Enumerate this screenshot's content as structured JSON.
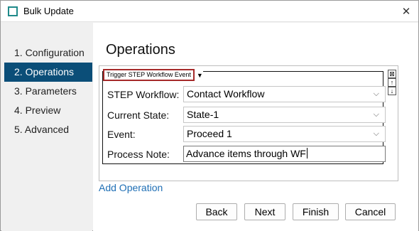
{
  "window": {
    "title": "Bulk Update",
    "close_glyph": "✕"
  },
  "icons": {
    "app": "window-icon",
    "close": "close-icon",
    "dropdown": "chevron-down-icon"
  },
  "sidebar": {
    "items": [
      {
        "label": "1. Configuration",
        "active": false
      },
      {
        "label": "2. Operations",
        "active": true
      },
      {
        "label": "3. Parameters",
        "active": false
      },
      {
        "label": "4. Preview",
        "active": false
      },
      {
        "label": "5. Advanced",
        "active": false
      }
    ]
  },
  "main": {
    "heading": "Operations",
    "operation": {
      "title": "Trigger STEP Workflow Event",
      "title_caret": "▼",
      "controls": {
        "remove": "⊠",
        "move_up": "↑",
        "move_down": "↓"
      },
      "fields": [
        {
          "label": "STEP Workflow:",
          "value": "Contact Workflow",
          "kind": "select"
        },
        {
          "label": "Current State:",
          "value": "State-1",
          "kind": "select"
        },
        {
          "label": "Event:",
          "value": "Proceed 1",
          "kind": "select"
        },
        {
          "label": "Process Note:",
          "value": "Advance items through WF",
          "kind": "text"
        }
      ]
    },
    "add_operation": "Add Operation"
  },
  "footer": {
    "back": "Back",
    "next": "Next",
    "finish": "Finish",
    "cancel": "Cancel"
  },
  "colors": {
    "accent": "#0b4e78",
    "link": "#1f6fb5",
    "highlight_border": "#a52a2a",
    "app_icon": "#1f8a8a"
  }
}
